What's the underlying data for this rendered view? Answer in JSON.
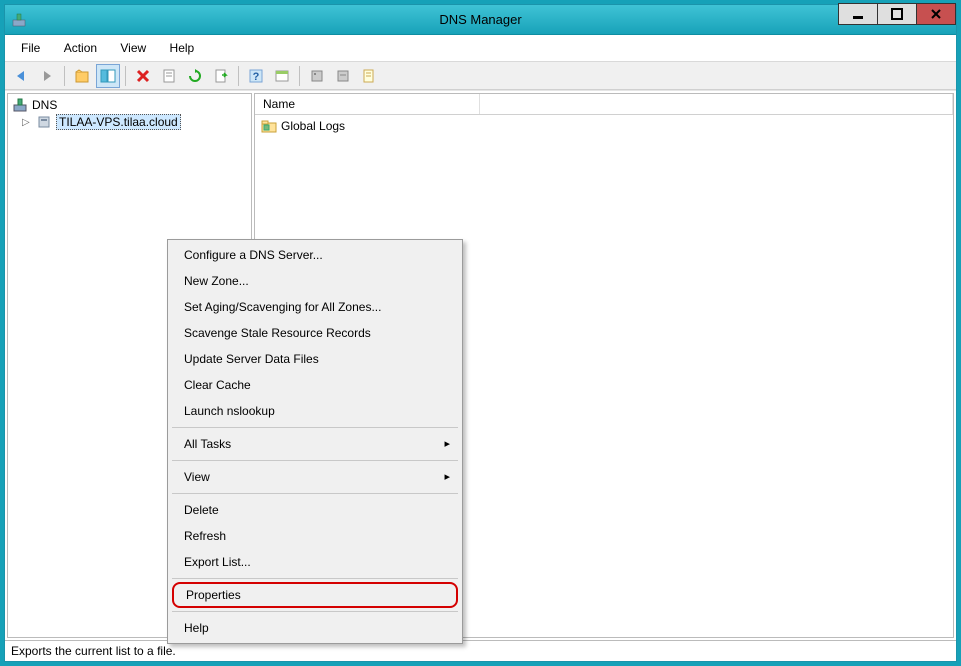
{
  "window": {
    "title": "DNS Manager"
  },
  "menubar": {
    "file": "File",
    "action": "Action",
    "view": "View",
    "help": "Help"
  },
  "tree": {
    "root": "DNS",
    "server": "TILAA-VPS.tilaa.cloud"
  },
  "list": {
    "header_name": "Name",
    "item0": "Global Logs"
  },
  "context": {
    "configure": "Configure a DNS Server...",
    "newzone": "New Zone...",
    "aging": "Set Aging/Scavenging for All Zones...",
    "scavenge": "Scavenge Stale Resource Records",
    "update": "Update Server Data Files",
    "clear": "Clear Cache",
    "nslookup": "Launch nslookup",
    "alltasks": "All Tasks",
    "view": "View",
    "delete": "Delete",
    "refresh": "Refresh",
    "export": "Export List...",
    "properties": "Properties",
    "help": "Help"
  },
  "status": {
    "text": "Exports the current list to a file."
  }
}
